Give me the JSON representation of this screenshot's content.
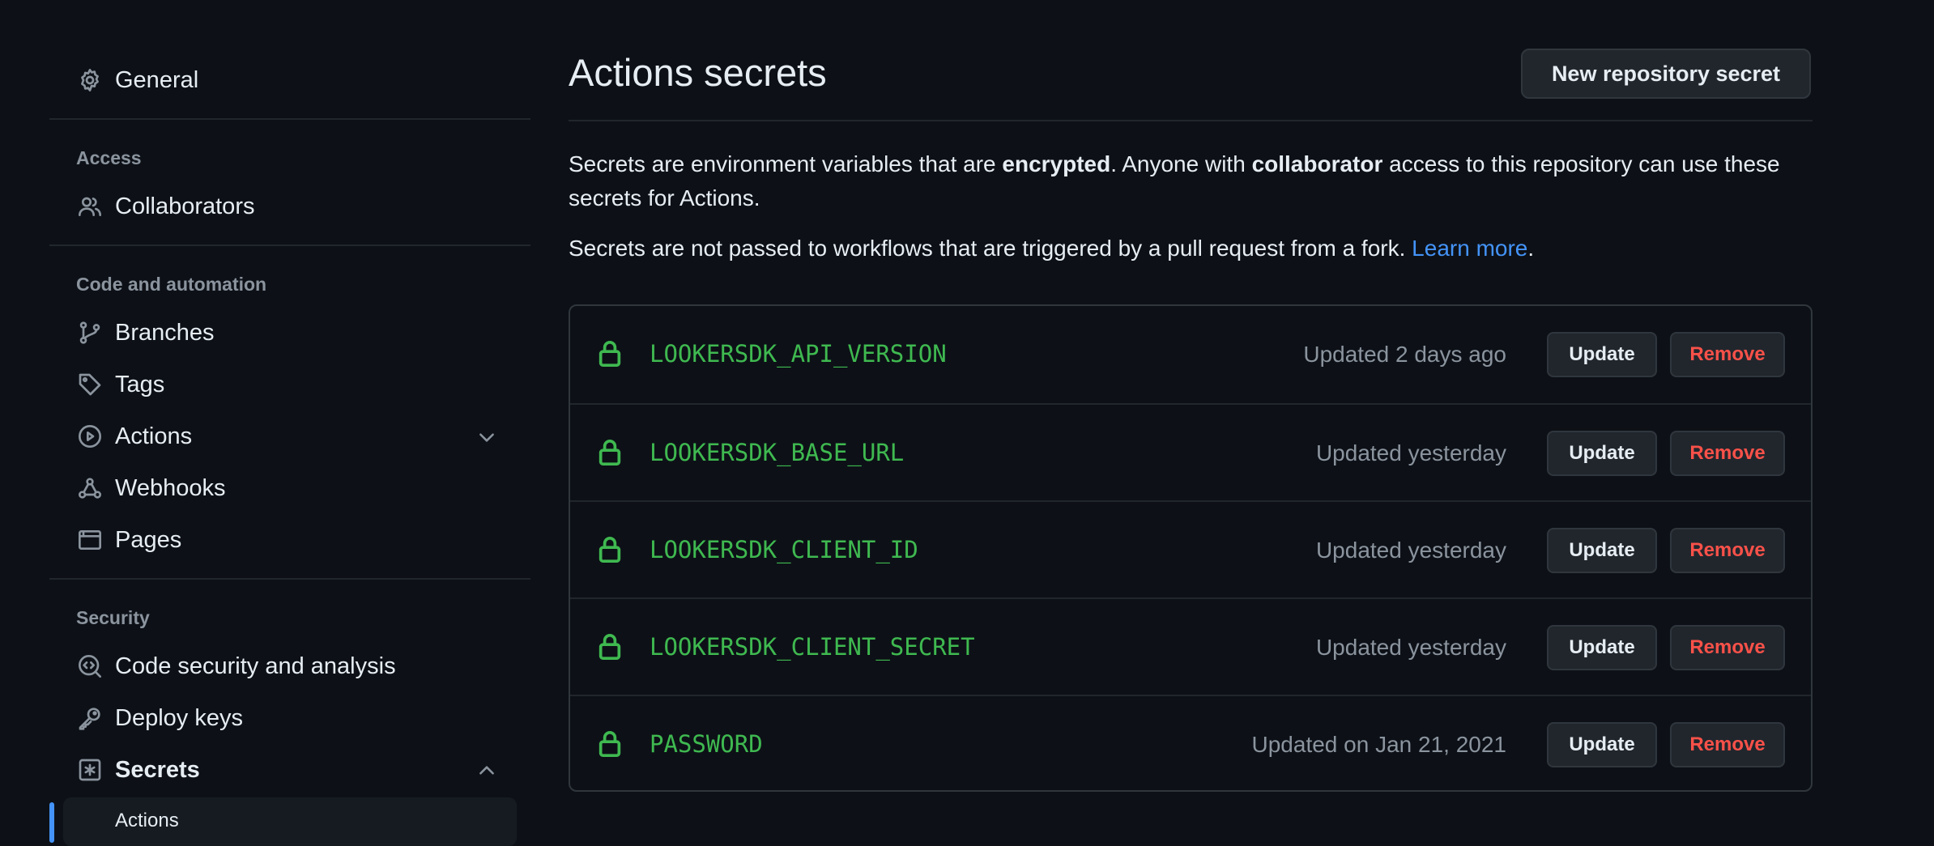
{
  "sidebar": {
    "general": "General",
    "access_label": "Access",
    "collaborators": "Collaborators",
    "code_automation_label": "Code and automation",
    "branches": "Branches",
    "tags": "Tags",
    "actions": "Actions",
    "webhooks": "Webhooks",
    "pages": "Pages",
    "security_label": "Security",
    "code_security": "Code security and analysis",
    "deploy_keys": "Deploy keys",
    "secrets": "Secrets",
    "secrets_sub_active": "Actions"
  },
  "main": {
    "title": "Actions secrets",
    "new_button": "New repository secret",
    "desc": {
      "p1_a": "Secrets are environment variables that are ",
      "p1_b": "encrypted",
      "p1_c": ". Anyone with ",
      "p1_d": "collaborator",
      "p1_e": " access to this repository can use these secrets for Actions.",
      "p2_a": "Secrets are not passed to workflows that are triggered by a pull request from a fork. ",
      "p2_link": "Learn more",
      "p2_b": "."
    },
    "secrets": [
      {
        "name": "LOOKERSDK_API_VERSION",
        "updated": "Updated 2 days ago"
      },
      {
        "name": "LOOKERSDK_BASE_URL",
        "updated": "Updated yesterday"
      },
      {
        "name": "LOOKERSDK_CLIENT_ID",
        "updated": "Updated yesterday"
      },
      {
        "name": "LOOKERSDK_CLIENT_SECRET",
        "updated": "Updated yesterday"
      },
      {
        "name": "PASSWORD",
        "updated": "Updated on Jan 21, 2021"
      }
    ],
    "update_label": "Update",
    "remove_label": "Remove"
  },
  "colors": {
    "background": "#0d1117",
    "accent_link": "#4493f8",
    "secret_green": "#3fb950",
    "remove_red": "#f85149"
  }
}
